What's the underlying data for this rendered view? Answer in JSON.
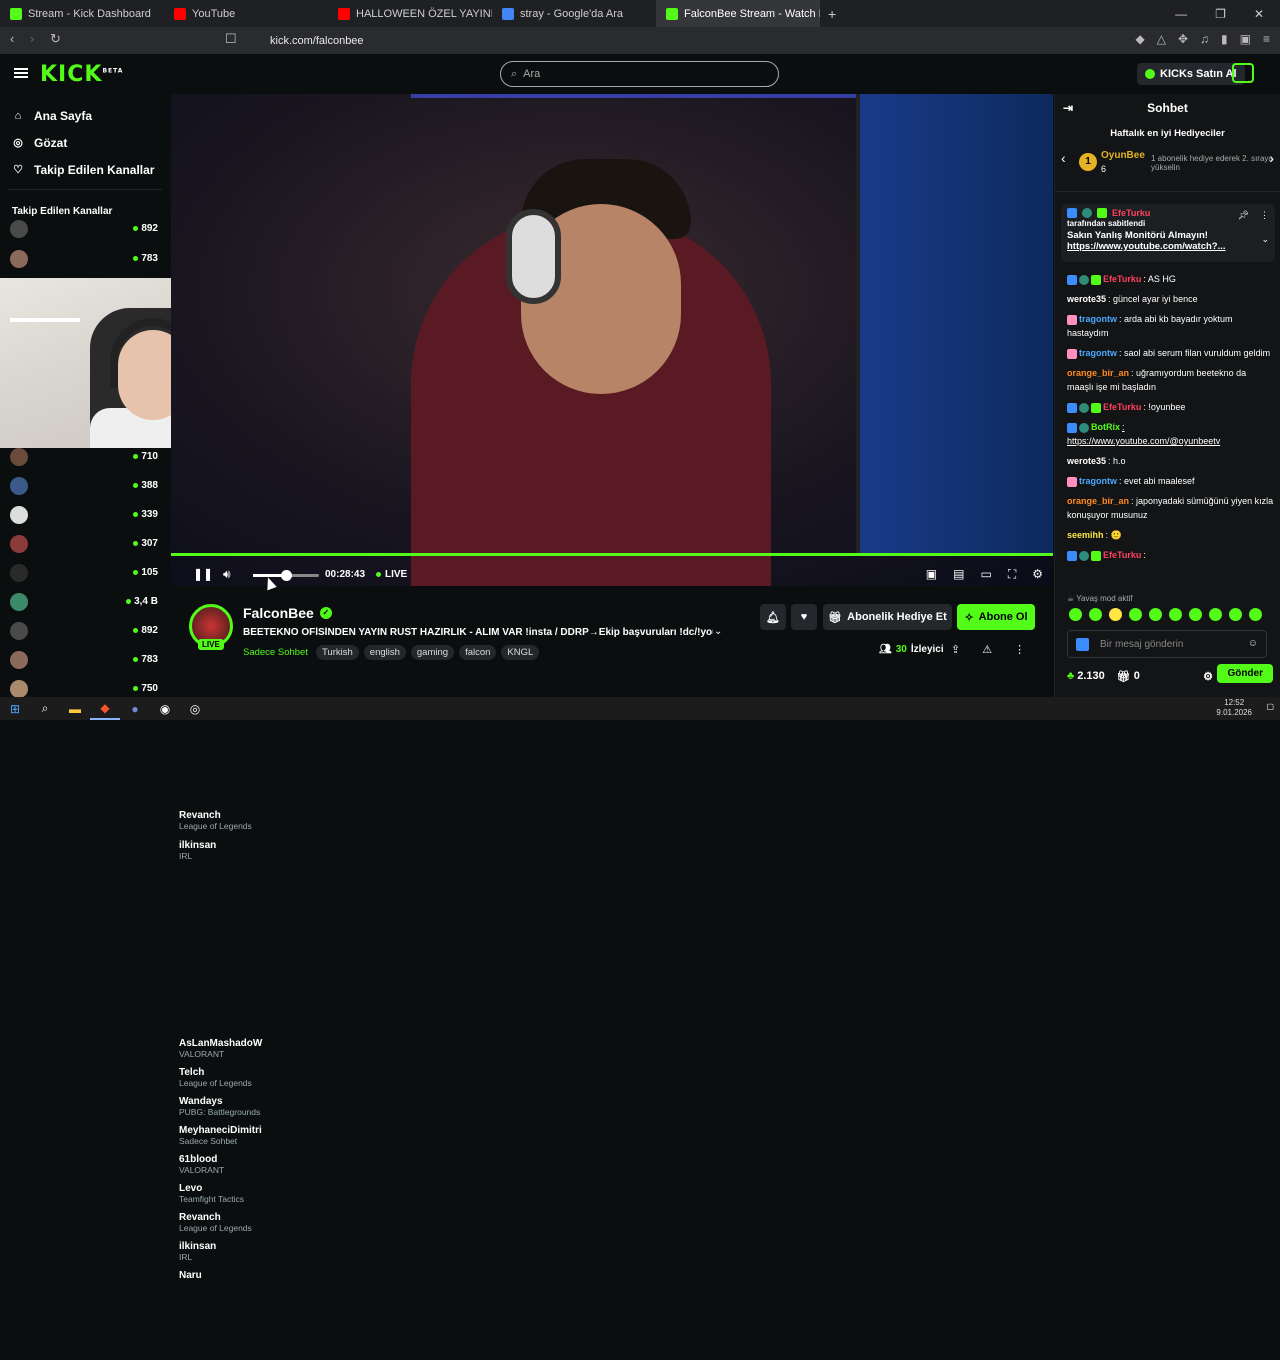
{
  "browser": {
    "tabs": [
      {
        "title": "Stream - Kick Dashboard",
        "color": "#53fc18"
      },
      {
        "title": "YouTube",
        "color": "#ff0000"
      },
      {
        "title": "HALLOWEEN ÖZEL YAYINI - YouTube",
        "color": "#ff0000"
      },
      {
        "title": "stray - Google'da Ara",
        "color": "#4285f4"
      },
      {
        "title": "FalconBee Stream - Watch Liv",
        "color": "#53fc18"
      }
    ],
    "url": "kick.com/falconbee"
  },
  "header": {
    "logo": "KICK",
    "logo_sup": "BETA",
    "search_placeholder": "Ara",
    "buy_kicks": "KICKs Satın Al"
  },
  "sidebar": {
    "nav": [
      {
        "label": "Ana Sayfa",
        "icon": "home-icon"
      },
      {
        "label": "Gözat",
        "icon": "compass-icon"
      },
      {
        "label": "Takip Edilen Kanallar",
        "icon": "heart-icon"
      }
    ],
    "section_title": "Takip Edilen Kanallar",
    "channels": [
      {
        "name": "Revanch",
        "game": "League of Legends",
        "viewers": "892",
        "color": "#4a4a4a"
      },
      {
        "name": "ilkinsan",
        "game": "IRL",
        "viewers": "783",
        "color": "#8a6a5a"
      },
      {
        "name": "AsLanMashadoW",
        "game": "VALORANT",
        "viewers": "710",
        "color": "#6a4a3a"
      },
      {
        "name": "Telch",
        "game": "League of Legends",
        "viewers": "388",
        "color": "#3a5a8a"
      },
      {
        "name": "Wandays",
        "game": "PUBG: Battlegrounds",
        "viewers": "339",
        "color": "#dddddd"
      },
      {
        "name": "MeyhaneciDimitri",
        "game": "Sadece Sohbet",
        "viewers": "307",
        "color": "#8a3a3a"
      },
      {
        "name": "61blood",
        "game": "VALORANT",
        "viewers": "105",
        "color": "#2a2a2a"
      },
      {
        "name": "Levo",
        "game": "Teamfight Tactics",
        "viewers": "3,4 B",
        "color": "#3a8a6a"
      },
      {
        "name": "Revanch",
        "game": "League of Legends",
        "viewers": "892",
        "color": "#4a4a4a"
      },
      {
        "name": "ilkinsan",
        "game": "IRL",
        "viewers": "783",
        "color": "#8a6a5a"
      },
      {
        "name": "Naru",
        "game": "",
        "viewers": "750",
        "color": "#aa8a6a"
      }
    ]
  },
  "player": {
    "time": "00:28:43",
    "live": "LIVE",
    "volume": 0.5
  },
  "stream": {
    "channel": "FalconBee",
    "live_badge": "LIVE",
    "title": "BEETEKNO OFİSİNDEN YAYIN RUST HAZIRLIK - ALIM VAR  !insta / DDRP→Ekip başvuruları !dc/!youtu...",
    "category": "Sadece Sohbet",
    "tags": [
      "Turkish",
      "english",
      "gaming",
      "falcon",
      "KNGL"
    ],
    "gift_sub_label": "Abonelik Hediye Et",
    "subscribe_label": "Abone Ol",
    "viewers": "30",
    "viewers_label": "İzleyici"
  },
  "chat": {
    "title": "Sohbet",
    "gifters_title": "Haftalık en iyi Hediyeciler",
    "top_gifter": {
      "rank": "1",
      "name": "OyunBee",
      "count": "6",
      "desc": "1 abonelik hediye ederek 2. sıraya yükselin"
    },
    "pinned": {
      "user": "EfeTurku",
      "sub": "tarafından sabitlendi",
      "message": "Sakın Yanlış Monitörü Almayın!",
      "link": "https://www.youtube.com/watch?..."
    },
    "messages": [
      {
        "user": "EfeTurku",
        "user_class": "u-red",
        "badges": [
          "b-blue",
          "b-teal",
          "b-green"
        ],
        "text": ": AS HG"
      },
      {
        "user": "werote35",
        "user_class": "u-white",
        "badges": [],
        "text": ": güncel ayar iyi bence"
      },
      {
        "user": "tragontw",
        "user_class": "u-blue",
        "badges": [
          "b-pink"
        ],
        "text": ": arda abi kb bayadır yoktum hastaydım"
      },
      {
        "user": "tragontw",
        "user_class": "u-blue",
        "badges": [
          "b-pink"
        ],
        "text": ": saol abi serum filan vuruldum geldim"
      },
      {
        "user": "orange_bir_an",
        "user_class": "u-orange",
        "badges": [],
        "text": ": uğramıyordum beetekno da maaşlı işe mi başladın"
      },
      {
        "user": "EfeTurku",
        "user_class": "u-red",
        "badges": [
          "b-blue",
          "b-teal",
          "b-green"
        ],
        "text": ": !oyunbee"
      },
      {
        "user": "BotRix",
        "user_class": "u-green",
        "badges": [
          "b-blue",
          "b-teal"
        ],
        "text": ": https://www.youtube.com/@oyunbeetv"
      },
      {
        "user": "werote35",
        "user_class": "u-white",
        "badges": [],
        "text": ": h.o"
      },
      {
        "user": "tragontw",
        "user_class": "u-blue",
        "badges": [
          "b-pink"
        ],
        "text": ": evet abi maalesef"
      },
      {
        "user": "orange_bir_an",
        "user_class": "u-orange",
        "badges": [],
        "text": ": japonyadaki sümüğünü yiyen kızla konuşuyor musunuz"
      },
      {
        "user": "seemihh",
        "user_class": "u-yellow",
        "badges": [],
        "text": ": 🙂"
      },
      {
        "user": "EfeTurku",
        "user_class": "u-red",
        "badges": [
          "b-blue",
          "b-teal",
          "b-green"
        ],
        "text": ":"
      }
    ],
    "slow_mode": "Yavaş mod aktif",
    "input_placeholder": "Bir mesaj gönderin",
    "points": "2.130",
    "gifts": "0",
    "send_label": "Gönder"
  },
  "taskbar": {
    "time": "12:52",
    "date": "9.01.2026"
  }
}
